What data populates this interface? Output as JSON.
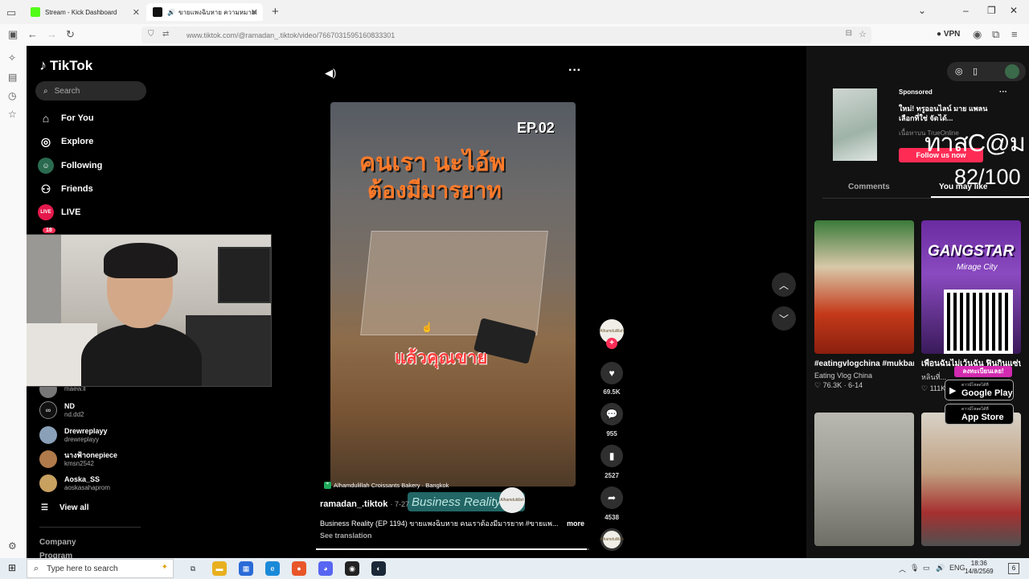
{
  "browser": {
    "tabs": [
      {
        "label": "Stream - Kick Dashboard",
        "favicon_color": "#53fc18"
      },
      {
        "label": "ขายแพงฉิบหาย ความหมายแ...",
        "favicon_color": "#111111"
      }
    ],
    "url": "www.tiktok.com/@ramadan_.tiktok/video/7667031595160833301",
    "vpn_label": "VPN"
  },
  "tiktok": {
    "logo": "TikTok",
    "search_placeholder": "Search",
    "menu": [
      {
        "label": "For You",
        "icon": "home-icon"
      },
      {
        "label": "Explore",
        "icon": "compass-icon"
      },
      {
        "label": "Following",
        "icon": "following-icon"
      },
      {
        "label": "Friends",
        "icon": "friends-icon"
      },
      {
        "label": "LIVE",
        "icon": "live-icon"
      }
    ],
    "live_badge_text": "LIVE",
    "messages_badge": "18",
    "following_accounts": [
      {
        "name": "",
        "handle": "maew.ll"
      },
      {
        "name": "ND",
        "handle": "nd.dd2"
      },
      {
        "name": "Drewreplayy",
        "handle": "drewreplayy"
      },
      {
        "name": "นางฟ้าonepiece",
        "handle": "kmsn2542"
      },
      {
        "name": "Aoska_SS",
        "handle": "aoskasahaprom"
      }
    ],
    "view_all": "View all",
    "company": "Company",
    "program": "Program"
  },
  "video": {
    "overlay_ep": "EP.02",
    "overlay_title_line1": "คนเรา นะไอ้พ",
    "overlay_title_line2": "ต้องมีมารยาท",
    "overlay_subtitle": "แล้วคุณขาย",
    "location": "Alhamdulillah Croissants Bakery · Bangkok",
    "brand_logo_text": "Business Reality",
    "author": "ramadan_.tiktok",
    "date": "7-27",
    "caption": "Business Reality (EP 1194) ขายแพงฉิบหาย คนเราต้องมีมารยาท #ขายแพ...",
    "more": "more",
    "see_translation": "See translation",
    "progress": 0.99,
    "likes": "69.5K",
    "comments": "955",
    "saves": "2527",
    "shares": "4538",
    "avatar_text": "Alhamdulillah"
  },
  "right_panel": {
    "sponsored": "Sponsored",
    "ad_title": "ใหม่! ทรูออนไลน์ มาย แพลน เลือกที่ใช่ จัดได้...",
    "ad_source": "เนื้อหาบน TrueOnline",
    "follow_button": "Follow us now",
    "watermark_brand": "ทาสC@ม",
    "score": "82/100",
    "tab_comments": "Comments",
    "tab_you_may_like": "You may like",
    "cards": [
      {
        "title": "#eatingvlogchina #mukbang #follows...",
        "author": "Eating Vlog China",
        "stat": "♡ 76.3K · 6-14"
      },
      {
        "title": "เพื่อนฉันไม่เว้นฉัน ฟินกินแซ่บ",
        "author": "หลินที่...",
        "stat": "♡ 111K"
      },
      {
        "title": "",
        "author": "",
        "stat": ""
      },
      {
        "title": "",
        "author": "",
        "stat": ""
      }
    ],
    "gangstar_title": "GANGSTAR",
    "gangstar_sub": "Mirage City",
    "gangstar_ribbon": "ลงทะเบียนเลย!",
    "google_play_small": "ดาวน์โหลดได้ที่",
    "google_play": "Google Play",
    "app_store_small": "ดาวน์โหลดได้ที่",
    "app_store": "App Store"
  },
  "taskbar": {
    "search_placeholder": "Type here to search",
    "lang": "ENG",
    "time": "18:36",
    "date": "14/8/2569",
    "notif_count": "6"
  }
}
